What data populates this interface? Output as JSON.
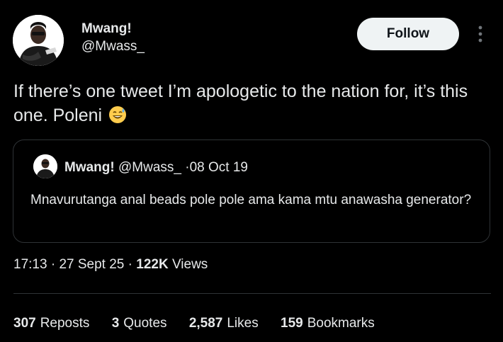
{
  "author": {
    "name": "Mwang!",
    "handle": "@Mwass_"
  },
  "follow_label": "Follow",
  "more_icon": "more-vertical-icon",
  "tweet_text": "If there’s one tweet I’m apologetic to the nation for, it’s this one. Poleni",
  "emoji": "grinning-sweat-emoji",
  "quote": {
    "name": "Mwang!",
    "handle": "@Mwass_",
    "separator": "·",
    "date": "08 Oct 19",
    "text": "Mnavurutanga anal beads pole pole ama kama mtu anawasha generator?"
  },
  "meta": {
    "time": "17:13",
    "sep1": "·",
    "date": "27 Sept 25",
    "sep2": "·",
    "views_count": "122K",
    "views_label": "Views"
  },
  "stats": {
    "reposts_count": "307",
    "reposts_label": "Reposts",
    "quotes_count": "3",
    "quotes_label": "Quotes",
    "likes_count": "2,587",
    "likes_label": "Likes",
    "bookmarks_count": "159",
    "bookmarks_label": "Bookmarks"
  },
  "colors": {
    "background": "#000000",
    "text": "#e7e9ea",
    "follow_bg": "#eff3f4",
    "border": "#2f3336"
  }
}
